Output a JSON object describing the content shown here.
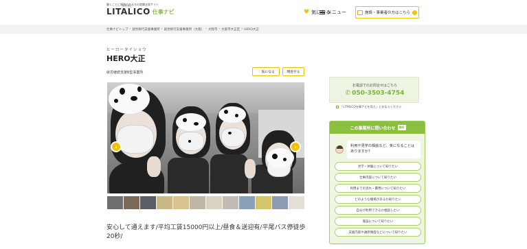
{
  "header": {
    "tagline": "働くことに障害のある方の就職支援サイト",
    "logo_text": "LITALICO",
    "logo_ruby": "りたりこ",
    "logo_sub": "仕事ナビ",
    "favorites_label": "気になる",
    "menu_label": "メニュー",
    "business_button_label": "施設・事業者の方はこちら"
  },
  "breadcrumb": {
    "items": [
      "仕事ナビトップ",
      "就労移行支援事業所",
      "就労移行支援事業所（大阪）",
      "大阪市",
      "大阪市大正区",
      "HERO大正"
    ]
  },
  "facility": {
    "kana": "ヒーロータイショウ",
    "name": "HERO大正",
    "category": "就労継続支援B型事業所",
    "favorite_button": "気になる",
    "apply_button": "問合せる"
  },
  "catch_copy": "安心して通えます/平均工賃15000円以上/昼食＆送迎有/平尾バス停徒歩20秒/",
  "contact": {
    "tel_caption": "お電話でのお問合せはこちら",
    "tel_number": "050-3503-4754",
    "tel_note": "「LITALICO仕事ナビを見た」とお伝えください",
    "inquiry_title": "この事業所に問い合わせ",
    "inquiry_badge": "無料",
    "inquiry_question": "利用や見学の相談など、気になることはありますか？",
    "options": [
      "見学・体験について知りたい",
      "仕事内容について知りたい",
      "利用までの流れ・費用について知りたい",
      "どのような職場があるか知りたい",
      "自分が利用できるか相談したい",
      "施設について知りたい",
      "支援内容や通所頻度などについて知りたい"
    ]
  },
  "colors": {
    "brand_green": "#8bbf3f",
    "accent_yellow": "#f2c200",
    "tel_green": "#7fb32f"
  }
}
